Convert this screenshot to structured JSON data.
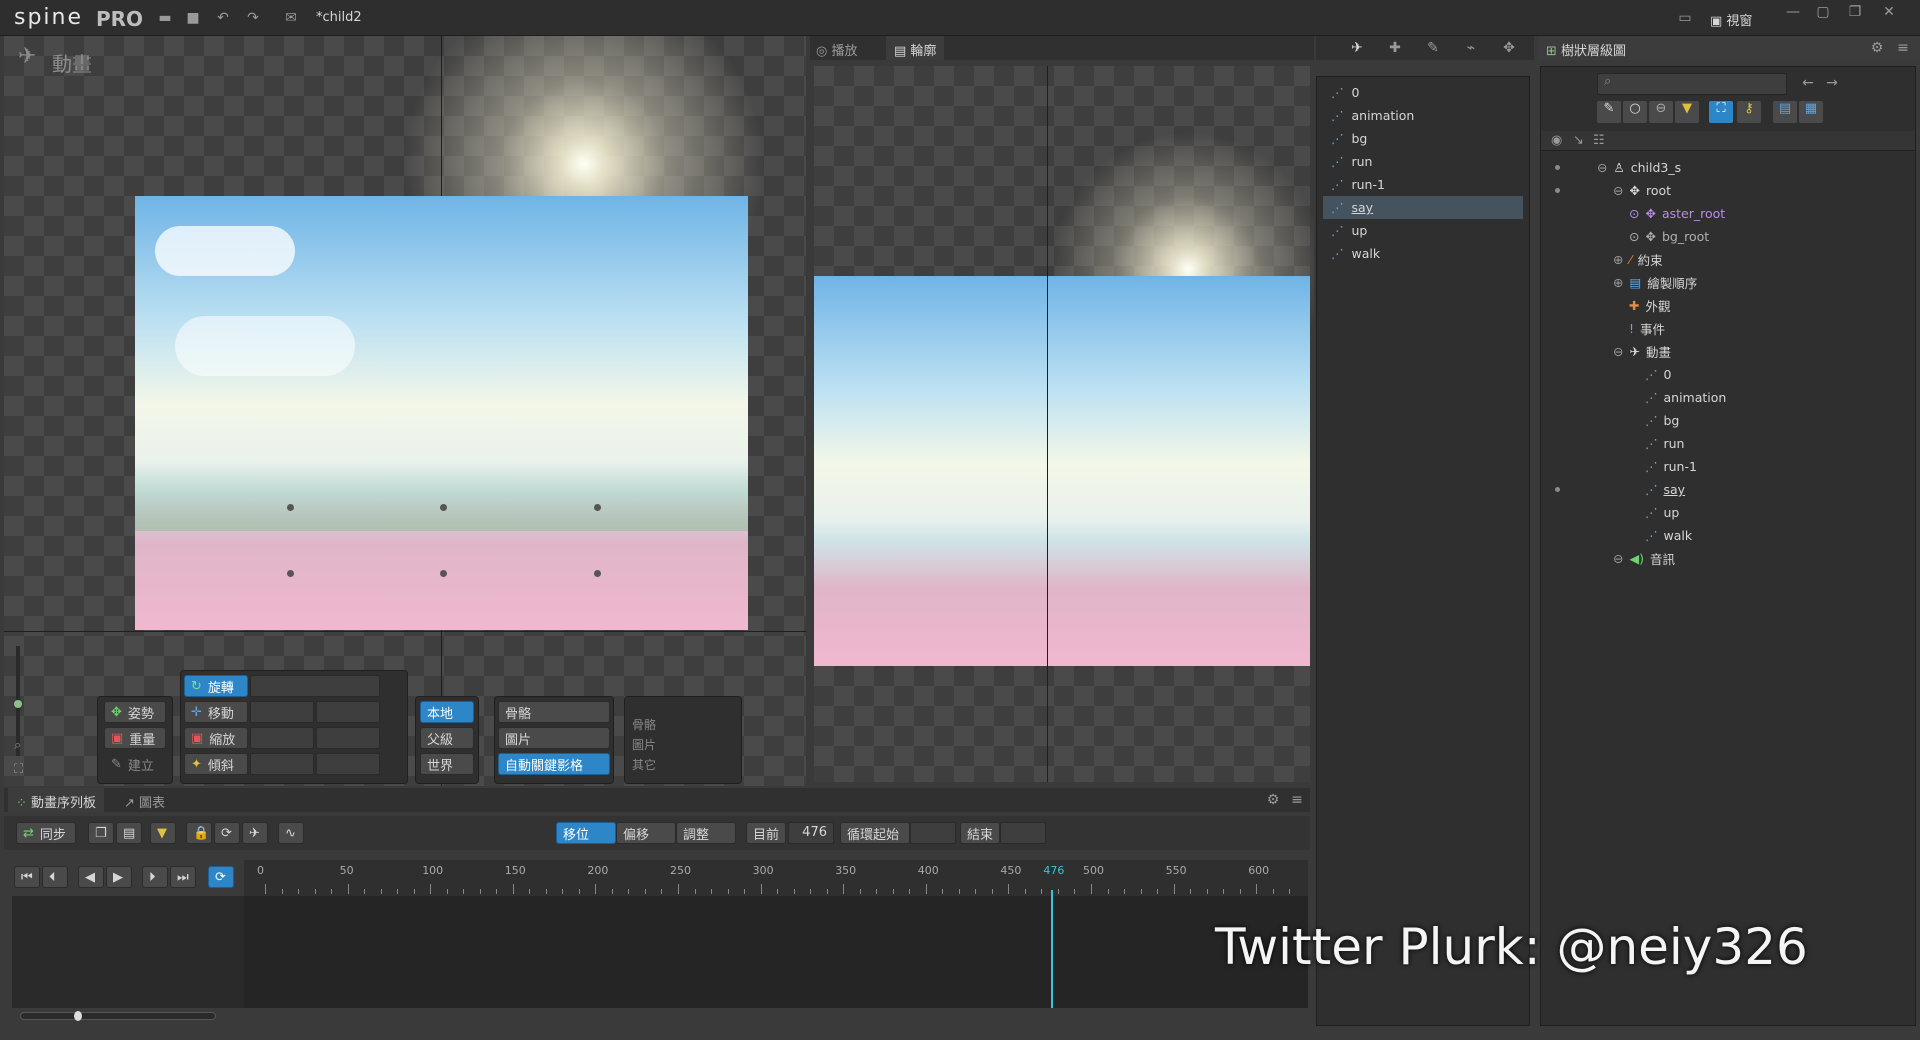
{
  "app": {
    "logo": "spine",
    "edition": "PRO",
    "file_title": "*child2",
    "window_menu": "視窗"
  },
  "viewport": {
    "mode_label": "動畫"
  },
  "preview": {
    "tab_play": "播放",
    "tab_outline": "輪廓"
  },
  "anim_list": {
    "items": [
      "0",
      "animation",
      "bg",
      "run",
      "run-1",
      "say",
      "up",
      "walk"
    ],
    "selected": "say"
  },
  "tree": {
    "title": "樹狀層級圖",
    "search_placeholder": "",
    "rows": [
      {
        "label": "child3_s"
      },
      {
        "label": "root"
      },
      {
        "label": "aster_root"
      },
      {
        "label": "bg_root"
      },
      {
        "label": "約束"
      },
      {
        "label": "繪製順序"
      },
      {
        "label": "外觀"
      },
      {
        "label": "事件"
      },
      {
        "label": "動畫"
      },
      {
        "label": "0"
      },
      {
        "label": "animation"
      },
      {
        "label": "bg"
      },
      {
        "label": "run"
      },
      {
        "label": "run-1"
      },
      {
        "label": "say"
      },
      {
        "label": "up"
      },
      {
        "label": "walk"
      },
      {
        "label": "音訊"
      }
    ]
  },
  "tools": {
    "pose": "姿勢",
    "weights": "重量",
    "create": "建立",
    "rotate": "旋轉",
    "translate": "移動",
    "scale": "縮放",
    "shear": "傾斜",
    "local": "本地",
    "parent": "父級",
    "world": "世界",
    "bones": "骨骼",
    "images": "圖片",
    "auto_key": "自動關鍵影格",
    "compensate_bones": "骨骼",
    "compensate_images": "圖片",
    "compensate_others": "其它"
  },
  "timeline": {
    "tab_dopesheet": "動畫序列板",
    "tab_graph": "圖表",
    "sync": "同步",
    "move": "移位",
    "offset": "偏移",
    "adjust": "調整",
    "current_label": "目前",
    "current_value": "476",
    "loop_start_label": "循環起始",
    "end_label": "結束",
    "ruler": [
      "0",
      "50",
      "100",
      "150",
      "200",
      "250",
      "300",
      "350",
      "400",
      "450",
      "476",
      "500",
      "550",
      "600"
    ],
    "playhead_frame": 476
  },
  "watermark": "Twitter  Plurk: @neiy326"
}
